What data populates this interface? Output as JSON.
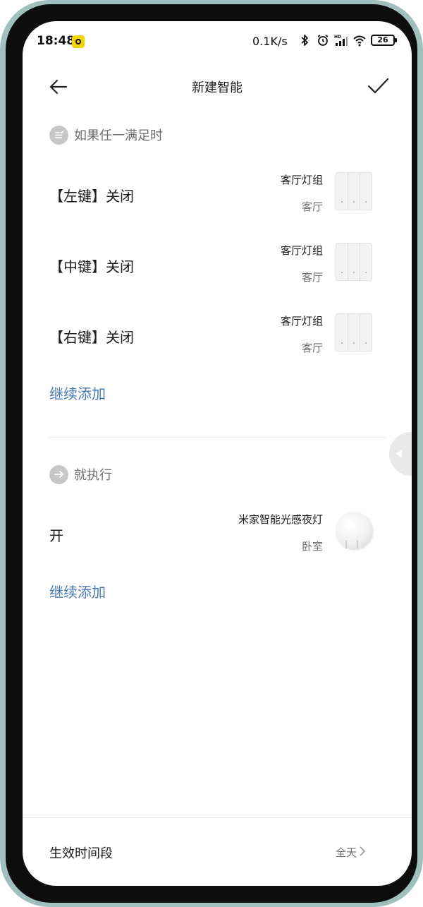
{
  "status": {
    "time": "18:48",
    "speed": "0.1K/s",
    "battery": "26",
    "icons": [
      "bluetooth-icon",
      "alarm-icon",
      "hd-signal-icon",
      "wifi-icon",
      "battery-icon"
    ]
  },
  "header": {
    "title": "新建智能",
    "back_icon": "arrow-left-icon",
    "confirm_icon": "checkmark-icon"
  },
  "conditions": {
    "label": "如果任一满足时",
    "icon": "list-check-icon",
    "items": [
      {
        "action": "【左键】关闭",
        "device": "客厅灯组",
        "room": "客厅",
        "image": "three-key-switch"
      },
      {
        "action": "【中键】关闭",
        "device": "客厅灯组",
        "room": "客厅",
        "image": "three-key-switch"
      },
      {
        "action": "【右键】关闭",
        "device": "客厅灯组",
        "room": "客厅",
        "image": "three-key-switch"
      }
    ],
    "add_more": "继续添加"
  },
  "actions": {
    "label": "就执行",
    "icon": "arrow-right-circle-icon",
    "items": [
      {
        "action": "开",
        "device": "米家智能光感夜灯",
        "room": "卧室",
        "image": "night-light"
      }
    ],
    "add_more": "继续添加"
  },
  "footer": {
    "label": "生效时间段",
    "value": "全天",
    "chevron_icon": "chevron-right-icon"
  },
  "colors": {
    "accent": "#4a78b5",
    "text_primary": "#1b1b1b",
    "text_secondary": "#6f6f6f"
  }
}
